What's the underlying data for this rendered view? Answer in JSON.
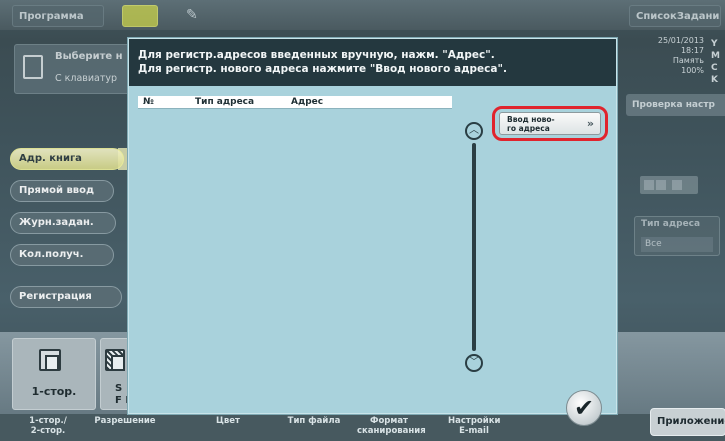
{
  "topbar": {
    "program_tab": "Программа",
    "joblist_tab": "СписокЗадания",
    "mid_icon": "document-icon",
    "edit_icon": "pencil-icon"
  },
  "header": {
    "prompt": "Выберите н",
    "source": "С клавиатур"
  },
  "status": {
    "datetime": "25/01/2013",
    "time": "18:17",
    "memory_label": "Память",
    "memory_value": "100%",
    "toner": [
      "Y",
      "M",
      "C",
      "K"
    ]
  },
  "right": {
    "check_settings": "Проверка настр",
    "address_type_label": "Тип адреса",
    "address_type_value": "Все"
  },
  "sidebar": {
    "items": [
      {
        "label": "Адр. книга",
        "active": true
      },
      {
        "label": "Прямой ввод",
        "active": false
      },
      {
        "label": "Журн.задан.",
        "active": false
      },
      {
        "label": "Кол.получ.",
        "active": false
      },
      {
        "label": "Регистрация",
        "active": false
      }
    ]
  },
  "dialog": {
    "line1": "Для регистр.адресов введенных вручную, нажм. \"Адрес\".",
    "line2": "Для регистр. нового адреса нажмите \"Ввод нового адреса\".",
    "table": {
      "columns": [
        "№",
        "Тип адреса",
        "Адрес"
      ]
    },
    "new_address_button": "Ввод ново-\nго адреса",
    "ok_icon": "check-icon"
  },
  "bottom": {
    "tile1_label": "1-стор.",
    "tile2_label": "S",
    "tile2_sub": "F B",
    "labels": [
      "1-стор./\n2-стор.",
      "Разрешение",
      "Цвет",
      "Тип файла",
      "Формат\nсканирования",
      "Настройки\nE-mail"
    ],
    "apps_button": "Приложение"
  },
  "colors": {
    "dialog_bg": "#a9d2dc",
    "dialog_header": "#24383f",
    "highlight": "#e0242d",
    "active_tab": "#f2f2c8"
  }
}
